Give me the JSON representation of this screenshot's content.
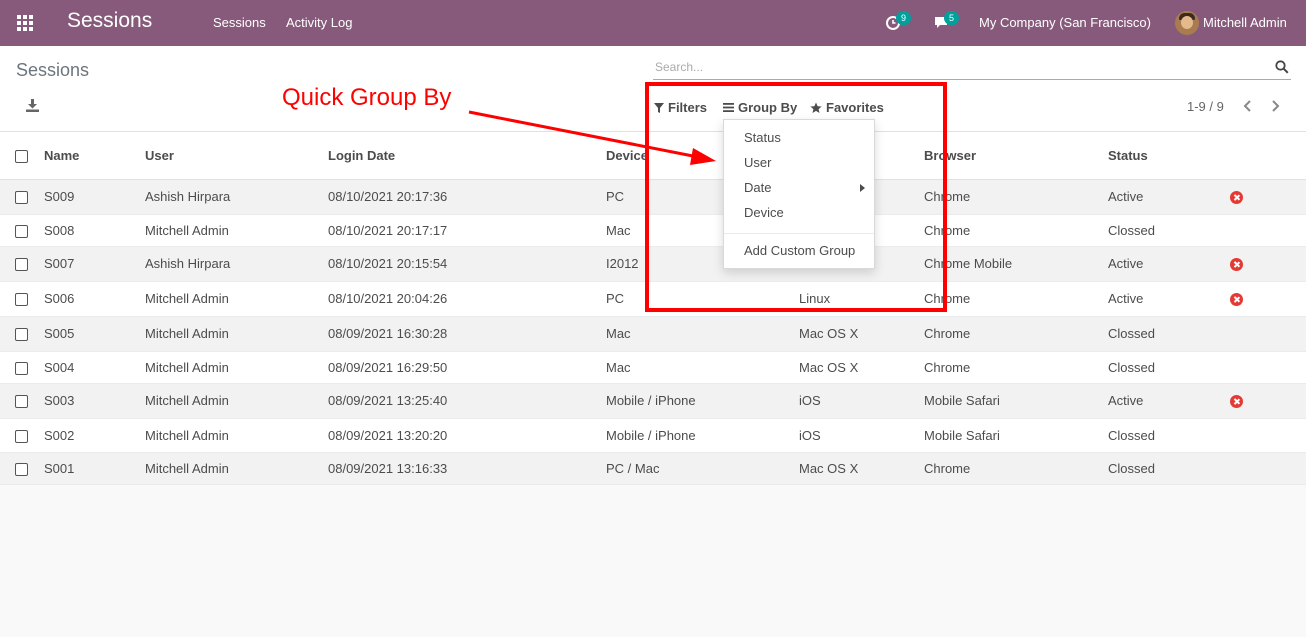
{
  "navbar": {
    "app_title": "Sessions",
    "menu": [
      "Sessions",
      "Activity Log"
    ],
    "activity_count": "9",
    "messages_count": "5",
    "company": "My Company (San Francisco)",
    "user": "Mitchell Admin"
  },
  "control_panel": {
    "title": "Sessions",
    "search_placeholder": "Search...",
    "filters_label": "Filters",
    "groupby_label": "Group By",
    "favorites_label": "Favorites",
    "pager": "1-9 / 9"
  },
  "groupby_menu": {
    "items": [
      "Status",
      "User",
      "Date",
      "Device"
    ],
    "custom_group": "Add Custom Group"
  },
  "annotation": {
    "text": "Quick Group By",
    "color": "#ff0000"
  },
  "table": {
    "headers": [
      "Name",
      "User",
      "Login Date",
      "Device",
      "",
      "Browser",
      "Status"
    ],
    "rows": [
      {
        "name": "S009",
        "user": "Ashish Hirpara",
        "date": "08/10/2021 20:17:36",
        "device": "PC",
        "os": "",
        "browser": "Chrome",
        "status": "Active",
        "action": true
      },
      {
        "name": "S008",
        "user": "Mitchell Admin",
        "date": "08/10/2021 20:17:17",
        "device": "Mac",
        "os": "",
        "browser": "Chrome",
        "status": "Clossed",
        "action": false
      },
      {
        "name": "S007",
        "user": "Ashish Hirpara",
        "date": "08/10/2021 20:15:54",
        "device": "I2012",
        "os": "",
        "browser": "Chrome Mobile",
        "status": "Active",
        "action": true
      },
      {
        "name": "S006",
        "user": "Mitchell Admin",
        "date": "08/10/2021 20:04:26",
        "device": "PC",
        "os": "Linux",
        "browser": "Chrome",
        "status": "Active",
        "action": true
      },
      {
        "name": "S005",
        "user": "Mitchell Admin",
        "date": "08/09/2021 16:30:28",
        "device": "Mac",
        "os": "Mac OS X",
        "browser": "Chrome",
        "status": "Clossed",
        "action": false
      },
      {
        "name": "S004",
        "user": "Mitchell Admin",
        "date": "08/09/2021 16:29:50",
        "device": "Mac",
        "os": "Mac OS X",
        "browser": "Chrome",
        "status": "Clossed",
        "action": false
      },
      {
        "name": "S003",
        "user": "Mitchell Admin",
        "date": "08/09/2021 13:25:40",
        "device": "Mobile / iPhone",
        "os": "iOS",
        "browser": "Mobile Safari",
        "status": "Active",
        "action": true
      },
      {
        "name": "S002",
        "user": "Mitchell Admin",
        "date": "08/09/2021 13:20:20",
        "device": "Mobile / iPhone",
        "os": "iOS",
        "browser": "Mobile Safari",
        "status": "Clossed",
        "action": false
      },
      {
        "name": "S001",
        "user": "Mitchell Admin",
        "date": "08/09/2021 13:16:33",
        "device": "PC / Mac",
        "os": "Mac OS X",
        "browser": "Chrome",
        "status": "Clossed",
        "action": false
      }
    ]
  },
  "colors": {
    "navbar": "#875a7b",
    "badge": "#00a09d",
    "danger": "#e53935"
  }
}
